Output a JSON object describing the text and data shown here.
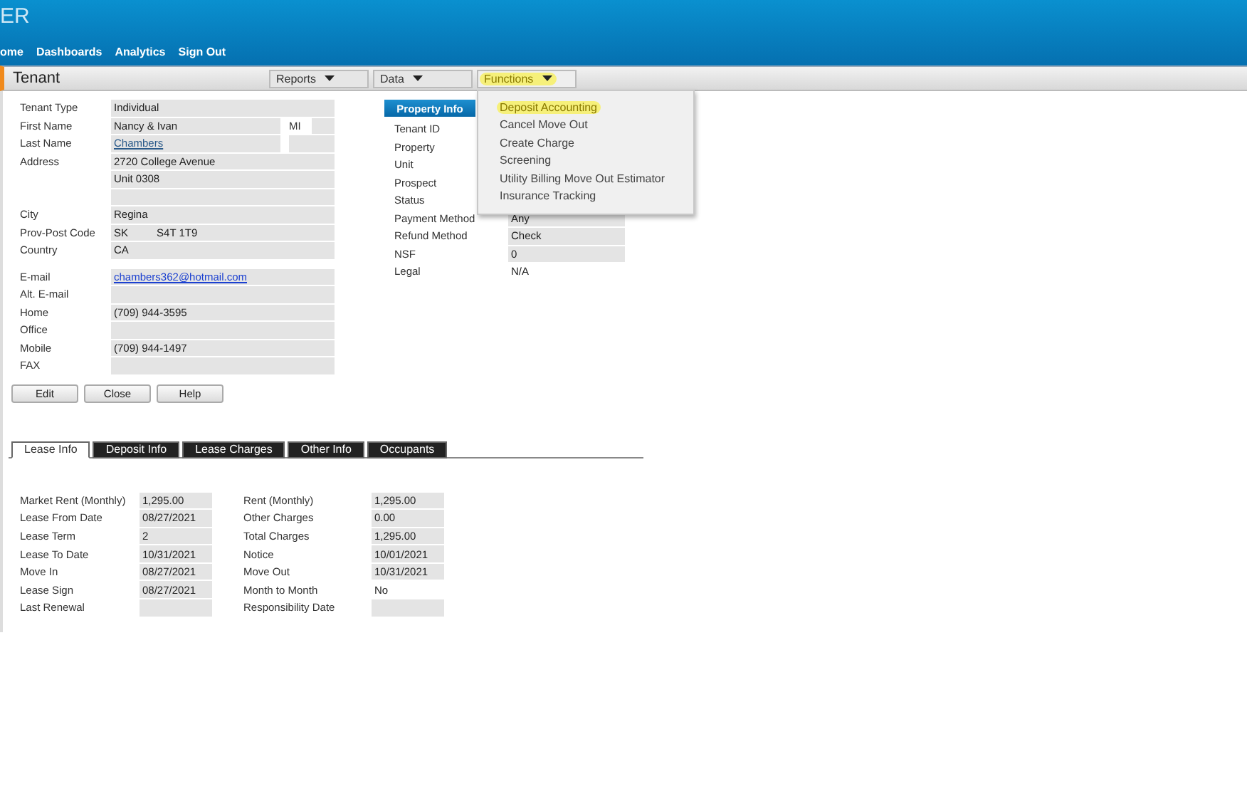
{
  "header": {
    "logo": "ER",
    "nav": [
      "ome",
      "Dashboards",
      "Analytics",
      "Sign Out"
    ]
  },
  "title_bar": {
    "title": "Tenant",
    "menus": [
      {
        "label": "Reports",
        "open": false
      },
      {
        "label": "Data",
        "open": false
      },
      {
        "label": "Functions",
        "open": true
      }
    ]
  },
  "functions_menu": [
    {
      "label": "Deposit Accounting",
      "selected": true
    },
    {
      "label": "Cancel Move Out",
      "selected": false
    },
    {
      "label": "Create Charge",
      "selected": false
    },
    {
      "label": "Screening",
      "selected": false
    },
    {
      "label": "Utility Billing Move Out Estimator",
      "selected": false
    },
    {
      "label": "Insurance Tracking",
      "selected": false
    }
  ],
  "tenant": {
    "sections": [
      [
        {
          "kind": "plain",
          "label": "Tenant Type",
          "value": "Individual"
        },
        {
          "kind": "name_mi",
          "label": "First Name",
          "value": "Nancy & Ivan",
          "mi_label": "MI"
        },
        {
          "kind": "name_extra",
          "label": "Last Name",
          "value": "Chambers",
          "link": true
        },
        {
          "kind": "plain",
          "label": "Address",
          "value": "2720 College Avenue"
        },
        {
          "kind": "plain",
          "value": "Unit 0308"
        },
        {
          "kind": "plain"
        },
        {
          "kind": "plain",
          "label": "City",
          "value": "Regina"
        },
        {
          "kind": "split",
          "label": "Prov-Post Code",
          "value": "SK",
          "value_2": "S4T 1T9"
        },
        {
          "kind": "plain",
          "label": "Country",
          "value": "CA"
        }
      ],
      [
        {
          "kind": "plain",
          "label": "E-mail",
          "value": "chambers362@hotmail.com",
          "link": true
        },
        {
          "kind": "plain",
          "label": "Alt. E-mail"
        },
        {
          "kind": "plain",
          "label": "Home",
          "value": "(709) 944-3595"
        },
        {
          "kind": "plain",
          "label": "Office"
        },
        {
          "kind": "plain",
          "label": "Mobile",
          "value": "(709) 944-1497"
        },
        {
          "kind": "plain",
          "label": "FAX"
        }
      ]
    ]
  },
  "buttons": [
    "Edit",
    "Close",
    "Help"
  ],
  "property_info": {
    "header": "Property Info",
    "rows": [
      {
        "label": "Tenant ID"
      },
      {
        "label": "Property"
      },
      {
        "label": "Unit"
      },
      {
        "label": "Prospect"
      },
      {
        "label": "Status"
      },
      {
        "label": "Payment Method",
        "value": "Any",
        "boxed": true
      },
      {
        "label": "Refund Method",
        "value": "Check",
        "boxed": true
      },
      {
        "label": "NSF",
        "value": "0",
        "boxed": true
      },
      {
        "label": "Legal",
        "value": "N/A",
        "boxed": false
      }
    ]
  },
  "tabs": [
    {
      "label": "Lease Info",
      "selected": true
    },
    {
      "label": "Deposit Info",
      "selected": false
    },
    {
      "label": "Lease Charges",
      "selected": false
    },
    {
      "label": "Other Info",
      "selected": false
    },
    {
      "label": "Occupants",
      "selected": false
    }
  ],
  "lease": {
    "left": [
      {
        "label": "Market Rent (Monthly)",
        "value": "1,295.00",
        "boxed": true
      },
      {
        "label": "Lease From Date",
        "value": "08/27/2021",
        "boxed": true
      },
      {
        "label": "Lease Term",
        "value": "2",
        "boxed": true
      },
      {
        "label": "Lease To Date",
        "value": "10/31/2021",
        "boxed": true
      },
      {
        "label": "Move In",
        "value": "08/27/2021",
        "boxed": true
      },
      {
        "label": "Lease Sign",
        "value": "08/27/2021",
        "boxed": true
      },
      {
        "label": "Last Renewal",
        "boxed": true
      }
    ],
    "right": [
      {
        "label": "Rent (Monthly)",
        "value": "1,295.00",
        "boxed": true
      },
      {
        "label": "Other Charges",
        "value": "0.00",
        "boxed": true
      },
      {
        "label": "Total Charges",
        "value": "1,295.00",
        "boxed": true
      },
      {
        "label": "Notice",
        "value": "10/01/2021",
        "boxed": true
      },
      {
        "label": "Move Out",
        "value": "10/31/2021",
        "boxed": true
      },
      {
        "label": "Month to Month",
        "value": "No",
        "boxed": false
      },
      {
        "label": "Responsibility Date",
        "boxed": true
      }
    ]
  }
}
